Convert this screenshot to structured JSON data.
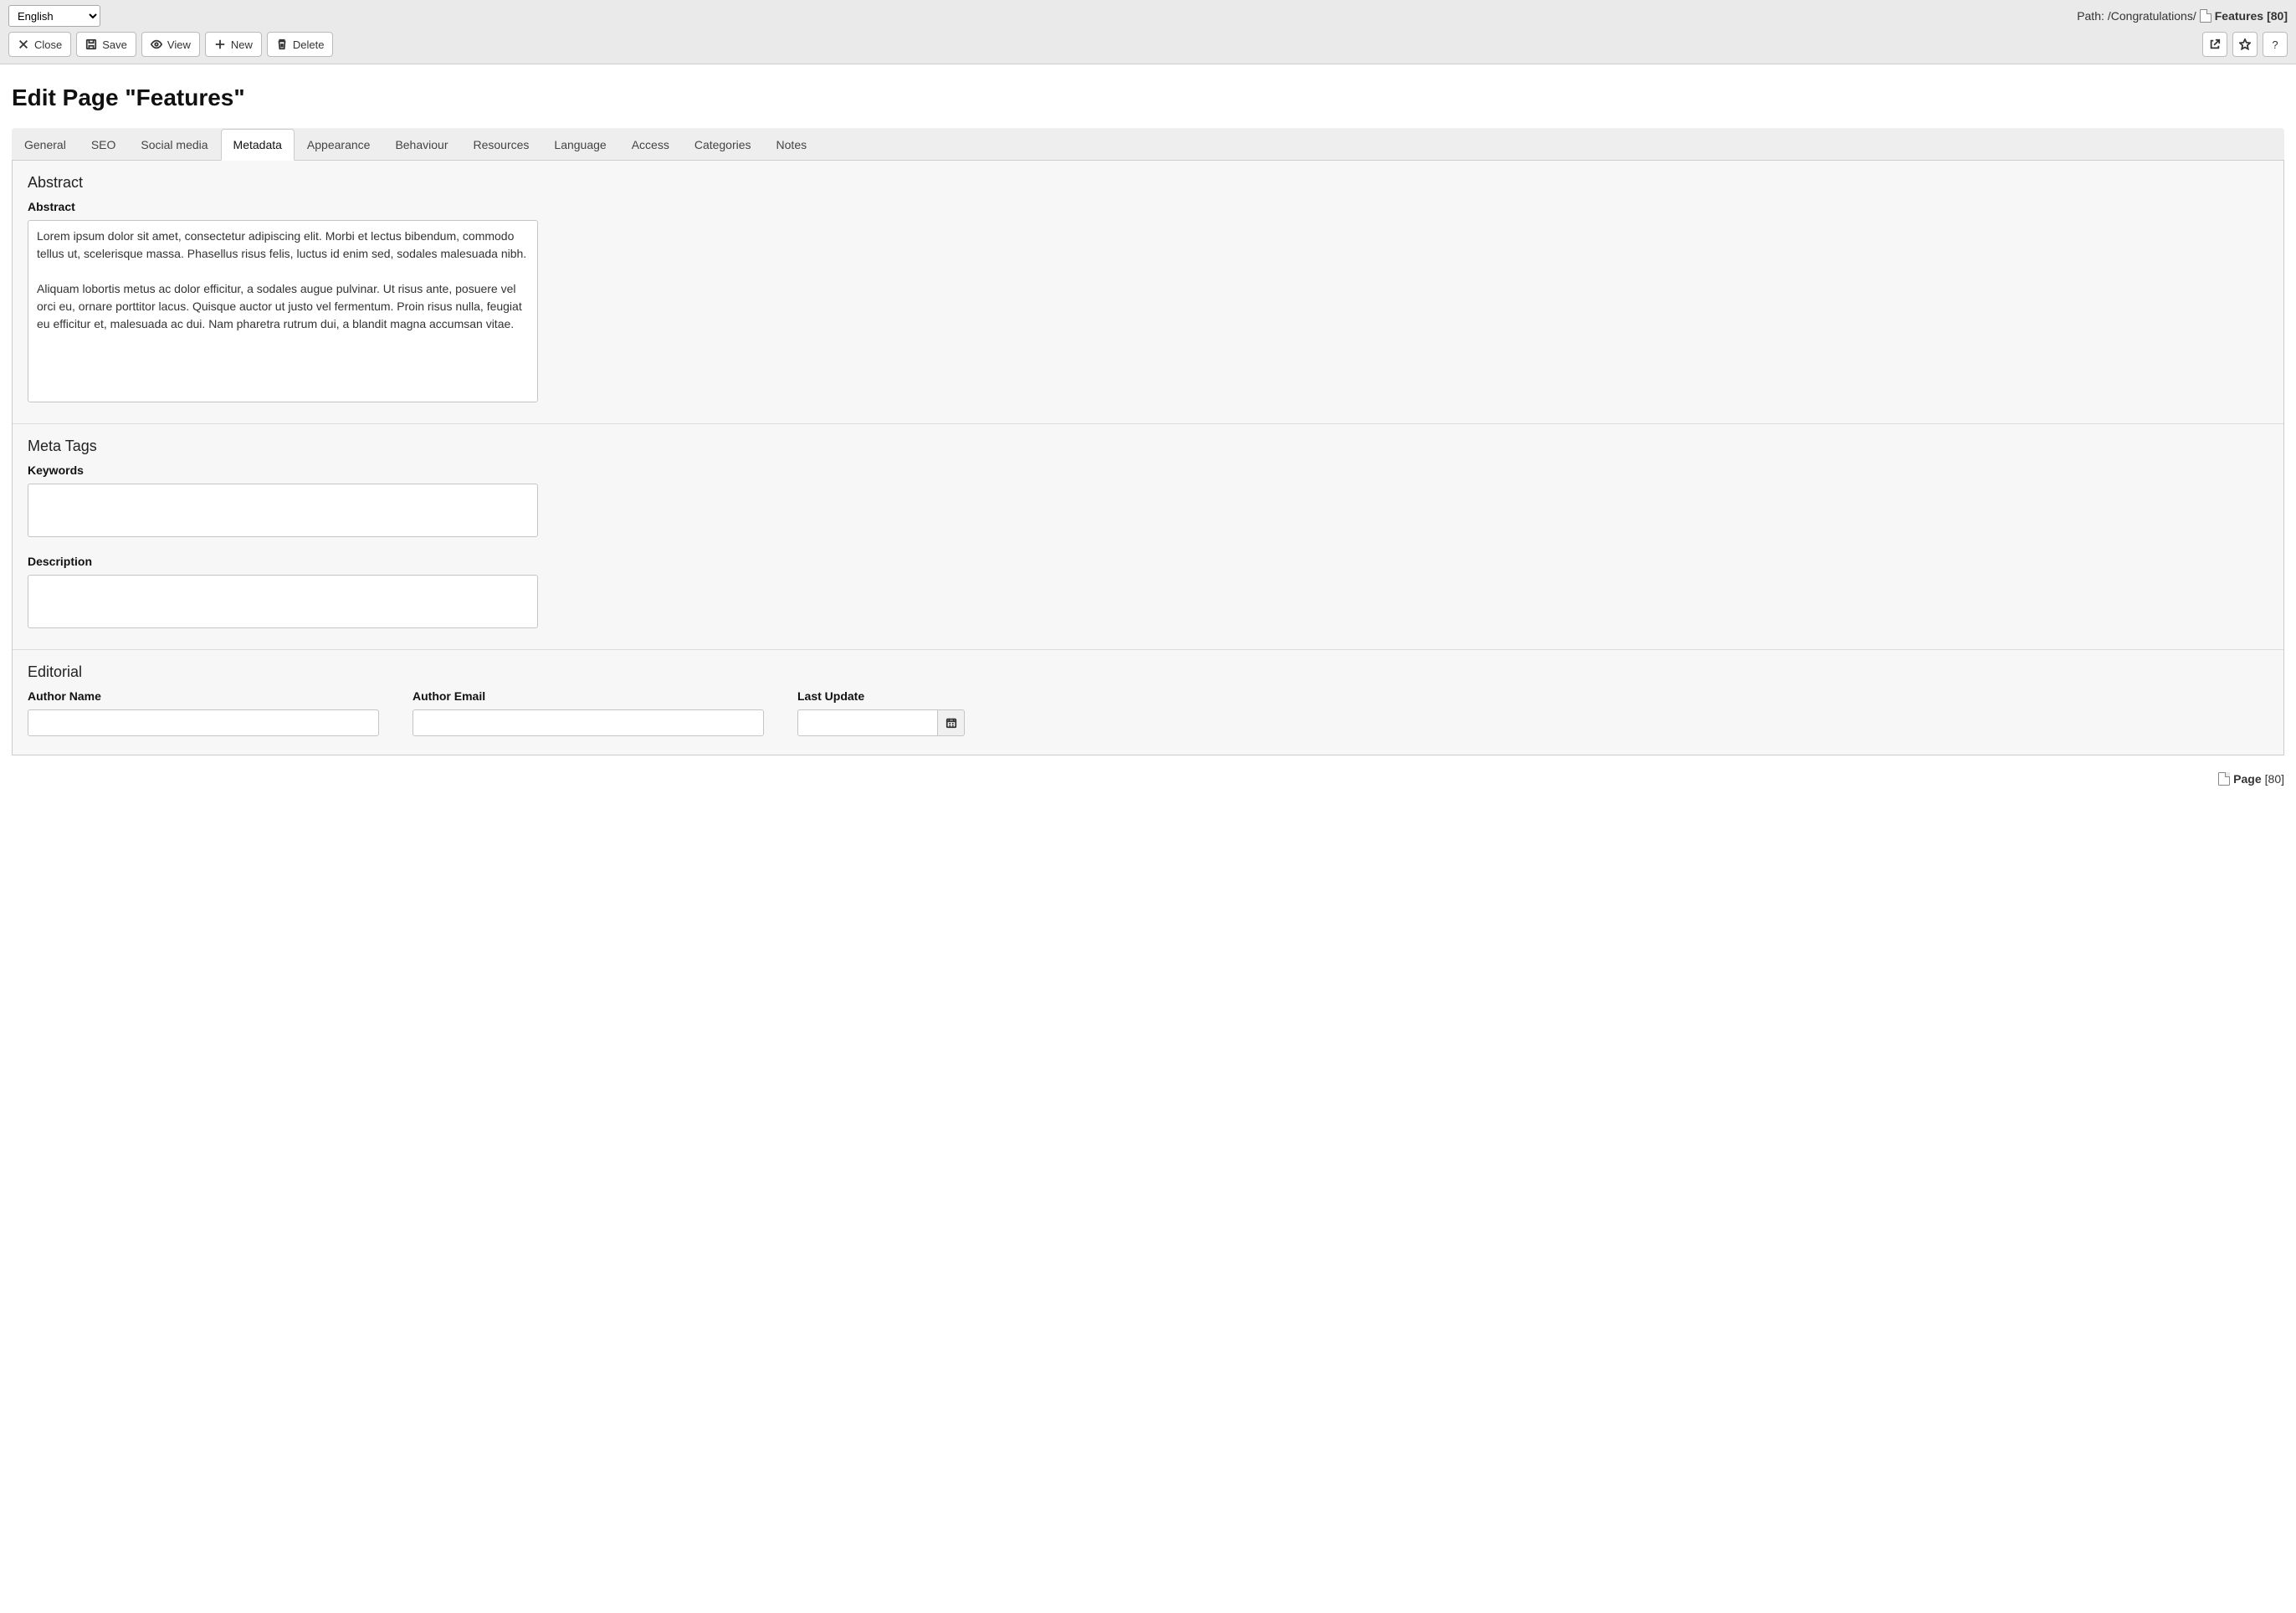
{
  "language": "English",
  "path": {
    "prefix": "Path: ",
    "crumb": "/Congratulations/",
    "current_name": "Features",
    "current_id": "[80]"
  },
  "toolbar": {
    "close": "Close",
    "save": "Save",
    "view": "View",
    "new": "New",
    "delete": "Delete",
    "help": "?"
  },
  "page_title": "Edit Page \"Features\"",
  "tabs": {
    "general": "General",
    "seo": "SEO",
    "social": "Social media",
    "metadata": "Metadata",
    "appearance": "Appearance",
    "behaviour": "Behaviour",
    "resources": "Resources",
    "language": "Language",
    "access": "Access",
    "categories": "Categories",
    "notes": "Notes"
  },
  "sections": {
    "abstract": {
      "title": "Abstract",
      "label": "Abstract",
      "value": "Lorem ipsum dolor sit amet, consectetur adipiscing elit. Morbi et lectus bibendum, commodo tellus ut, scelerisque massa. Phasellus risus felis, luctus id enim sed, sodales malesuada nibh.\n\nAliquam lobortis metus ac dolor efficitur, a sodales augue pulvinar. Ut risus ante, posuere vel orci eu, ornare porttitor lacus. Quisque auctor ut justo vel fermentum. Proin risus nulla, feugiat eu efficitur et, malesuada ac dui. Nam pharetra rutrum dui, a blandit magna accumsan vitae."
    },
    "meta": {
      "title": "Meta Tags",
      "keywords_label": "Keywords",
      "keywords_value": "",
      "description_label": "Description",
      "description_value": ""
    },
    "editorial": {
      "title": "Editorial",
      "author_name_label": "Author Name",
      "author_name_value": "",
      "author_email_label": "Author Email",
      "author_email_value": "",
      "last_update_label": "Last Update",
      "last_update_value": ""
    }
  },
  "footer": {
    "type": "Page",
    "id": "[80]"
  }
}
